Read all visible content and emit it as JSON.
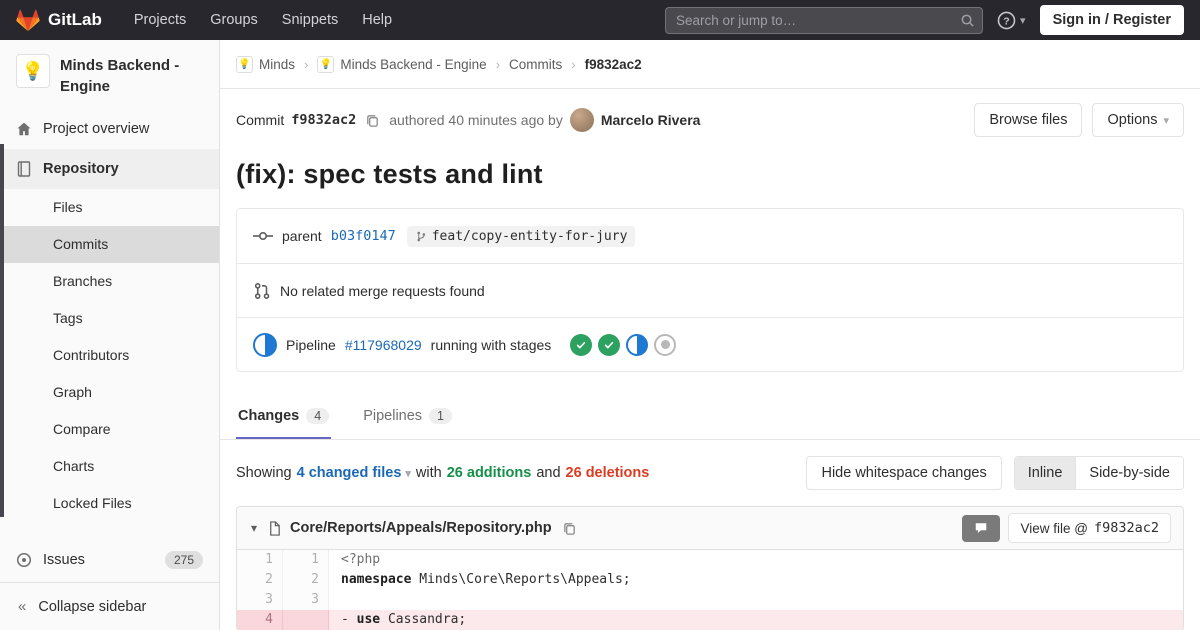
{
  "navbar": {
    "brand": "GitLab",
    "menu": [
      "Projects",
      "Groups",
      "Snippets",
      "Help"
    ],
    "search_placeholder": "Search or jump to…",
    "sign_in_label": "Sign in / Register"
  },
  "icons": {
    "chevron_down": "▾",
    "breadcrumb_separator": "›",
    "collapse": "«",
    "project_logo": "💡"
  },
  "sidebar": {
    "project_name": "Minds Backend - Engine",
    "overview_label": "Project overview",
    "repository_label": "Repository",
    "repo_items": [
      {
        "label": "Files"
      },
      {
        "label": "Commits",
        "active": true
      },
      {
        "label": "Branches"
      },
      {
        "label": "Tags"
      },
      {
        "label": "Contributors"
      },
      {
        "label": "Graph"
      },
      {
        "label": "Compare"
      },
      {
        "label": "Charts"
      },
      {
        "label": "Locked Files"
      }
    ],
    "issues_label": "Issues",
    "issues_count": "275",
    "collapse_label": "Collapse sidebar"
  },
  "breadcrumb": {
    "items": [
      "Minds",
      "Minds Backend - Engine",
      "Commits",
      "f9832ac2"
    ]
  },
  "commit": {
    "label": "Commit",
    "sha": "f9832ac2",
    "authored_text": "authored 40 minutes ago by",
    "author_name": "Marcelo Rivera",
    "browse_files_label": "Browse files",
    "options_label": "Options",
    "title": "(fix): spec tests and lint"
  },
  "infobox": {
    "parent_label": "parent",
    "parent_sha": "b03f0147",
    "branch_name": "feat/copy-entity-for-jury",
    "merge_request_text": "No related merge requests found",
    "pipeline_label": "Pipeline",
    "pipeline_id": "#117968029",
    "pipeline_text": "running with stages",
    "stages": [
      "passed",
      "passed",
      "running",
      "created"
    ]
  },
  "tabs": {
    "changes_label": "Changes",
    "changes_count": "4",
    "pipelines_label": "Pipelines",
    "pipelines_count": "1"
  },
  "toolbar": {
    "showing_label": "Showing",
    "files_dropdown": "4 changed files",
    "with_label": "with",
    "additions": "26 additions",
    "and_label": "and",
    "deletions": "26 deletions",
    "hide_whitespace_label": "Hide whitespace changes",
    "inline_label": "Inline",
    "side_by_side_label": "Side-by-side"
  },
  "file": {
    "path": "Core/Reports/Appeals/Repository.php",
    "view_file_label": "View file @",
    "view_file_sha": "f9832ac2",
    "lines": [
      {
        "old": "1",
        "new": "1",
        "code": "<?php"
      },
      {
        "old": "2",
        "new": "2",
        "kw": "namespace",
        "rest": " Minds\\Core\\Reports\\Appeals;"
      },
      {
        "old": "3",
        "new": "3",
        "code": ""
      },
      {
        "old": "4",
        "new": "",
        "sign": "- ",
        "kw": "use",
        "rest": " Cassandra;"
      }
    ]
  },
  "colors": {
    "brand_red": "#e24329",
    "brand_orange": "#fc6d26",
    "brand_yellow": "#fca326",
    "link": "#1b69b6",
    "success": "#2da160",
    "danger": "#db3b21",
    "running": "#1f78d1",
    "tab_active": "#6666c4"
  }
}
